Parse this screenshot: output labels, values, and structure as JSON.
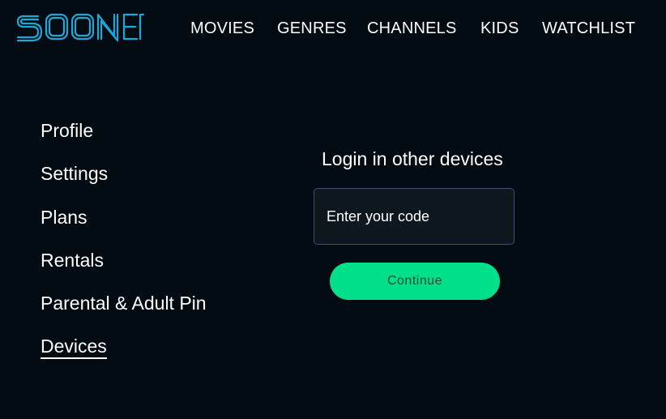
{
  "brand": {
    "logo_text": "SOONER",
    "logo_color": "#1aa8d6"
  },
  "nav": {
    "items": [
      {
        "label": "MOVIES"
      },
      {
        "label": "GENRES"
      },
      {
        "label": "CHANNELS"
      },
      {
        "label": "KIDS"
      },
      {
        "label": "WATCHLIST"
      }
    ]
  },
  "sidebar": {
    "items": [
      {
        "label": "Profile"
      },
      {
        "label": "Settings"
      },
      {
        "label": "Plans"
      },
      {
        "label": "Rentals"
      },
      {
        "label": "Parental & Adult Pin"
      },
      {
        "label": "Devices",
        "active": true
      }
    ]
  },
  "login": {
    "title": "Login in other devices",
    "code_placeholder": "Enter your code",
    "continue_label": "Continue"
  },
  "colors": {
    "background": "#020a12",
    "accent": "#00e08a",
    "input_border": "#3a4e78"
  }
}
